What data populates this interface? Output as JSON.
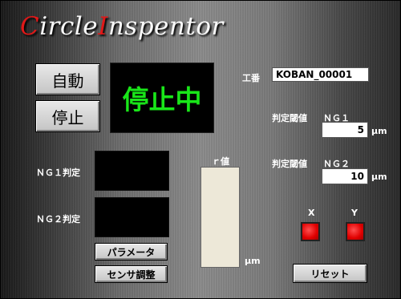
{
  "header": {
    "title_c": "C",
    "title_ircle": "ircle",
    "title_i": "I",
    "title_nspentor": "nspentor"
  },
  "controls": {
    "auto_label": "自動",
    "stop_label": "停止",
    "status_text": "停止中"
  },
  "judgments": {
    "ng1_label": "ＮＧ１判定",
    "ng2_label": "ＮＧ２判定"
  },
  "buttons": {
    "params_label": "パラメータ",
    "sensor_label": "センサ調整",
    "reset_label": "リセット"
  },
  "r_value": {
    "label": "ｒ値",
    "unit": "μm"
  },
  "work": {
    "label": "工番",
    "value": "KOBAN_00001"
  },
  "thresholds": {
    "ng1_label": "判定閾値",
    "ng1_name": "ＮＧ１",
    "ng1_value": "5",
    "ng1_unit": "μm",
    "ng2_label": "判定閾値",
    "ng2_name": "ＮＧ２",
    "ng2_value": "10",
    "ng2_unit": "μm"
  },
  "indicators": {
    "x_label": "X",
    "y_label": "Y",
    "color": "#ff0000"
  },
  "colors": {
    "status_text": "#19e619",
    "title_accent": "#e01818"
  }
}
